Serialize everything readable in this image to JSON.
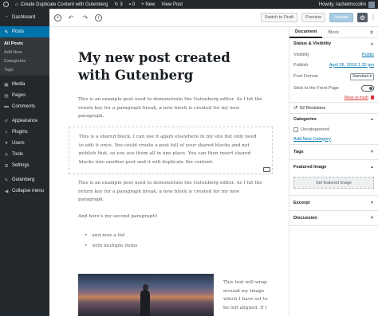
{
  "adminbar": {
    "site_name": "Create Duplicate Content with Gutenberg",
    "updates": "3",
    "comments": "0",
    "new_label": "+ New",
    "view_post": "View Post",
    "howdy": "Howdy, rachelmccollin"
  },
  "sidebar": {
    "dashboard": "Dashboard",
    "posts": "Posts",
    "posts_sub": [
      "All Posts",
      "Add New",
      "Categories",
      "Tags"
    ],
    "items_after": [
      {
        "label": "Media",
        "icon": "media-icon"
      },
      {
        "label": "Pages",
        "icon": "pages-icon"
      },
      {
        "label": "Comments",
        "icon": "comments-icon"
      }
    ],
    "items_after2": [
      {
        "label": "Appearance",
        "icon": "appearance-icon"
      },
      {
        "label": "Plugins",
        "icon": "plugins-icon"
      },
      {
        "label": "Users",
        "icon": "users-icon"
      },
      {
        "label": "Tools",
        "icon": "tools-icon"
      },
      {
        "label": "Settings",
        "icon": "settings-icon"
      }
    ],
    "gutenberg": "Gutenberg",
    "collapse": "Collapse menu"
  },
  "toolbar": {
    "switch_to_draft": "Switch to Draft",
    "preview": "Preview",
    "update": "Update"
  },
  "post": {
    "title": "My new post created with Gutenberg",
    "para1": "This is an example post used to demonstrate the Gutenberg editor. As I hit the return key for a paragraph break, a new block is created for my new paragraph.",
    "shared": "This is a shared block. I can use it again elsewhere in my site but only need to edit it once. You could create a post full of your shared blocks and not publish that, so you ave them all in one place. You can then insert shared blocks into another post and it will duplicate the content.",
    "para2": "This is an example post used to demonstrate the Gutenberg editor. As I hit the return key for a paragraph break, a new block is created for my new paragraph.",
    "para3": "And here's my second paragraph!",
    "list": [
      "and now a list",
      "with multiple items"
    ],
    "wrap_text": "This text will wrap around my image which I have set to be left aligned. If I"
  },
  "panel": {
    "tab_document": "Document",
    "tab_block": "Block",
    "status_heading": "Status & Visibility",
    "visibility_label": "Visibility",
    "visibility_value": "Public",
    "publish_label": "Publish",
    "publish_value": "April 26, 2018 1:32 pm",
    "format_label": "Post Format",
    "format_value": "Standard",
    "sticky_label": "Stick to the Front Page",
    "trash": "Move to trash",
    "revisions": "62 Revisions",
    "categories_heading": "Categories",
    "category_item": "Uncategorized",
    "add_category": "Add New Category",
    "tags_heading": "Tags",
    "featured_heading": "Featured Image",
    "featured_button": "Set featured image",
    "excerpt_heading": "Excerpt",
    "discussion_heading": "Discussion"
  },
  "colors": {
    "admin_dark": "#23282d",
    "accent_blue": "#0073aa",
    "trash_red": "#dc3232"
  }
}
